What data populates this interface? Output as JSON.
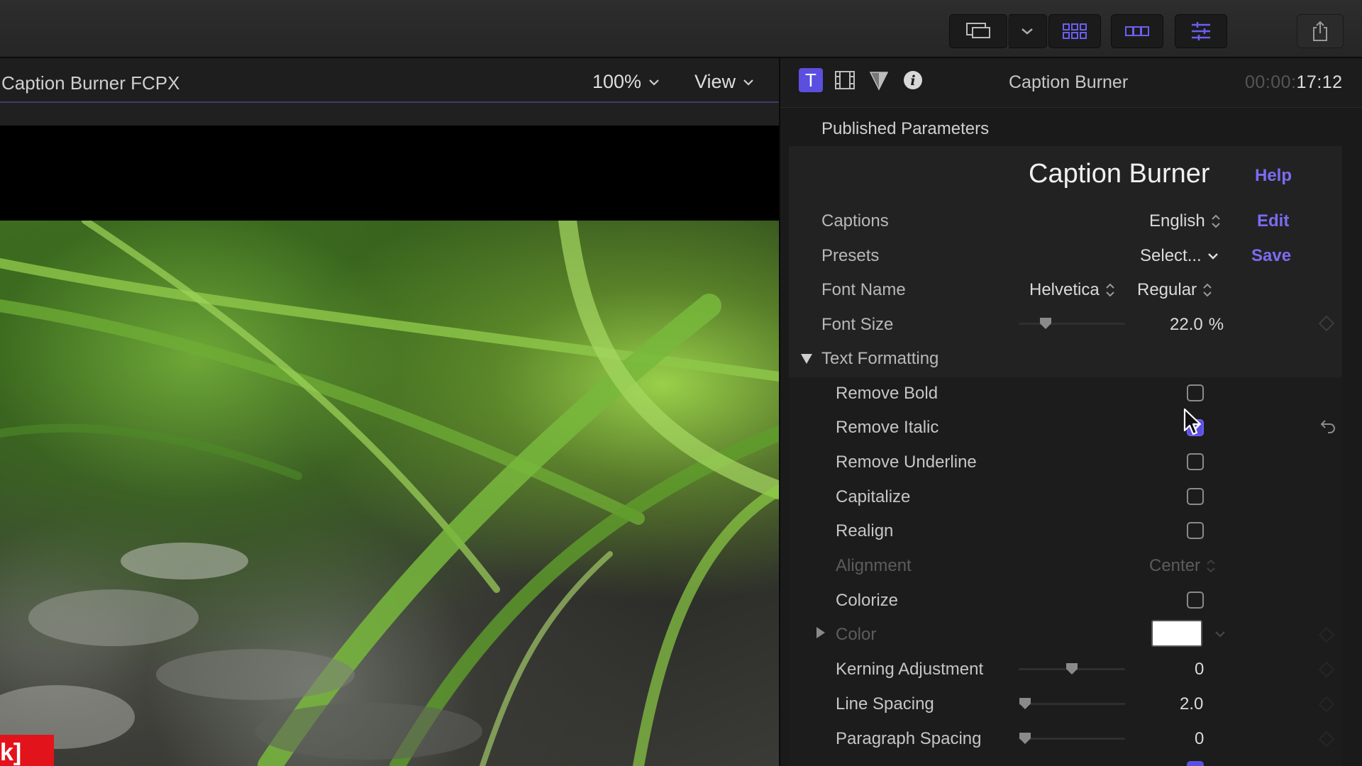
{
  "toolbar": {
    "buttons": [
      "layout-icon",
      "chevron-down-icon",
      "browser-grid-icon",
      "timeline-strip-icon",
      "inspector-sliders-icon",
      "share-icon"
    ],
    "accent": "#5b4fe0"
  },
  "viewer": {
    "title": "Caption Burner FCPX",
    "zoom": "100%",
    "view_label": "View",
    "badge_text": "k]"
  },
  "inspector": {
    "tabs": [
      "text-tab-icon",
      "video-tab-icon",
      "filter-tab-icon",
      "info-tab-icon"
    ],
    "text_tab_glyph": "T",
    "title": "Caption Burner",
    "timecode_dim": "00:00:",
    "timecode": "17:12",
    "section_label": "Published Parameters",
    "effect_name": "Caption Burner",
    "help_link": "Help",
    "rows": {
      "captions": {
        "label": "Captions",
        "value": "English",
        "action": "Edit"
      },
      "presets": {
        "label": "Presets",
        "value": "Select...",
        "action": "Save"
      },
      "font_name": {
        "label": "Font Name",
        "family": "Helvetica",
        "style": "Regular"
      },
      "font_size": {
        "label": "Font Size",
        "value": "22.0",
        "unit": "%",
        "slider_fraction": 0.22
      },
      "text_formatting": {
        "label": "Text Formatting",
        "expanded": true
      },
      "remove_bold": {
        "label": "Remove Bold",
        "checked": false
      },
      "remove_italic": {
        "label": "Remove Italic",
        "checked": true
      },
      "remove_underline": {
        "label": "Remove Underline",
        "checked": false
      },
      "capitalize": {
        "label": "Capitalize",
        "checked": false
      },
      "realign": {
        "label": "Realign",
        "checked": false
      },
      "alignment": {
        "label": "Alignment",
        "value": "Center",
        "enabled": false
      },
      "colorize": {
        "label": "Colorize",
        "checked": false
      },
      "color": {
        "label": "Color",
        "swatch": "#ffffff",
        "enabled": false
      },
      "kerning": {
        "label": "Kerning Adjustment",
        "value": "0",
        "slider_fraction": 0.5
      },
      "line_spacing": {
        "label": "Line Spacing",
        "value": "2.0",
        "slider_fraction": 0.0
      },
      "paragraph_spacing": {
        "label": "Paragraph Spacing",
        "value": "0",
        "slider_fraction": 0.0
      }
    }
  }
}
